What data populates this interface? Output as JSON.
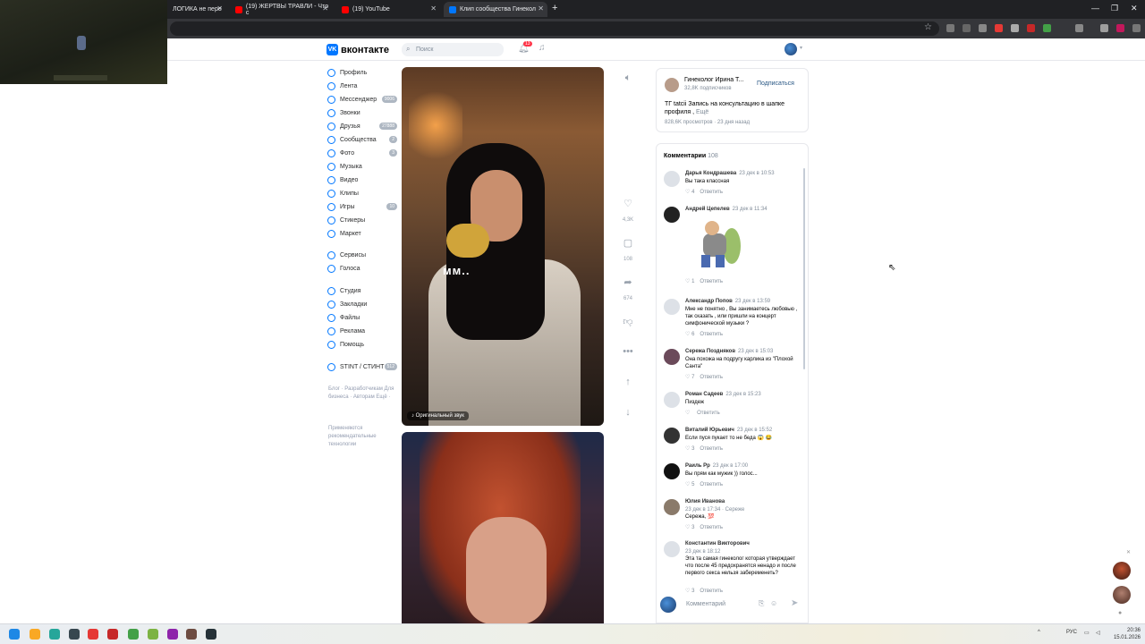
{
  "browser": {
    "tabs": [
      {
        "title": "ЛОГИКА не пере",
        "favicon": "page-icon"
      },
      {
        "title": "(19) ЖЕРТВЫ ТРАВЛИ - Что с",
        "favicon": "youtube-icon"
      },
      {
        "title": "(19) YouTube",
        "favicon": "youtube-icon"
      },
      {
        "title": "Клип сообщества Гинекол",
        "favicon": "vk-icon",
        "active": true
      }
    ],
    "new_tab": "+"
  },
  "vk": {
    "logo_text": "вконтакте",
    "search_placeholder": "Поиск",
    "notifications_count": "13"
  },
  "sidebar": {
    "items": [
      {
        "label": "Профиль",
        "count": ""
      },
      {
        "label": "Лента",
        "count": ""
      },
      {
        "label": "Мессенджер",
        "count": "9006"
      },
      {
        "label": "Звонки",
        "count": ""
      },
      {
        "label": "Друзья",
        "count": "27888"
      },
      {
        "label": "Сообщества",
        "count": "2"
      },
      {
        "label": "Фото",
        "count": "3"
      },
      {
        "label": "Музыка",
        "count": ""
      },
      {
        "label": "Видео",
        "count": ""
      },
      {
        "label": "Клипы",
        "count": ""
      },
      {
        "label": "Игры",
        "count": "10"
      },
      {
        "label": "Стикеры",
        "count": ""
      },
      {
        "label": "Маркет",
        "count": ""
      },
      {
        "label": "Сервисы",
        "count": ""
      },
      {
        "label": "Голоса",
        "count": ""
      },
      {
        "label": "Студия",
        "count": ""
      },
      {
        "label": "Закладки",
        "count": ""
      },
      {
        "label": "Файлы",
        "count": ""
      },
      {
        "label": "Реклама",
        "count": ""
      },
      {
        "label": "Помощь",
        "count": ""
      },
      {
        "label": "STINT / СТИНТ",
        "count": "512"
      }
    ],
    "footer_links": "Блог · Разработчикам Для бизнеса · Авторам Ещё ·",
    "footer_note": "Применяются рекомендательные технологии"
  },
  "clip": {
    "caption": "мм..",
    "sound_label": "♪ Оригинальный звук",
    "likes": "4,3K",
    "comments": "108",
    "shares": "674"
  },
  "author": {
    "name": "Гинеколог Ирина Т...",
    "subscribers": "32,8K подписчиков",
    "subscribe_label": "Подписаться",
    "description": "ТГ tatcii Запись на консультацию в шапке профиля ,",
    "more_label": "Ещё",
    "stats": "828,6K просмотров · 23 дня назад"
  },
  "comments": {
    "title": "Комментарии",
    "count": "108",
    "reply_label": "Ответить",
    "input_placeholder": "Комментарий",
    "items": [
      {
        "name": "Дарья Кондрашева",
        "date": "23 дек в 10:53",
        "text": "Вы така классная",
        "likes": "4"
      },
      {
        "name": "Андрей Цепелев",
        "date": "23 дек в 11:34",
        "text": "",
        "likes": "1"
      },
      {
        "name": "Александр Попов",
        "date": "23 дек в 13:59",
        "text": "Мне не понятно , Вы занимаетесь любовью , так сказать , или пришли на концерт симфонической музыки ?",
        "likes": "6"
      },
      {
        "name": "Сережа Поздняков",
        "date": "23 дек в 15:03",
        "text": "Она похожа на подругу карлика из \"Плохой Санта\"",
        "likes": "7"
      },
      {
        "name": "Роман Садеев",
        "date": "23 дек в 15:23",
        "text": "Пиздеж",
        "likes": ""
      },
      {
        "name": "Виталий Юрьевич",
        "date": "23 дек в 15:52",
        "text": "Если пуся пукает то не беда 😱 😂",
        "likes": "3"
      },
      {
        "name": "Раиль Рр",
        "date": "23 дек в 17:00",
        "text": "Вы прям как мужик )) голос...",
        "likes": "5"
      },
      {
        "name": "Юлия Иванова",
        "date": "23 дек в 17:34 · Сереже",
        "text": "Сережа, 💯",
        "likes": "3"
      },
      {
        "name": "Константин Викторович",
        "date": "23 дек в 18:12",
        "text": "Эта та самая гинеколог которая утверждает что после 45 предохранятся ненадо и после первого секса нельзя забеременеть?",
        "likes": "3"
      }
    ]
  },
  "taskbar": {
    "lang": "РУС",
    "time": "20:36",
    "date": "15.01.2026"
  },
  "colors": {
    "vk_blue": "#0077ff",
    "link": "#2a5885",
    "muted": "#818c99"
  }
}
